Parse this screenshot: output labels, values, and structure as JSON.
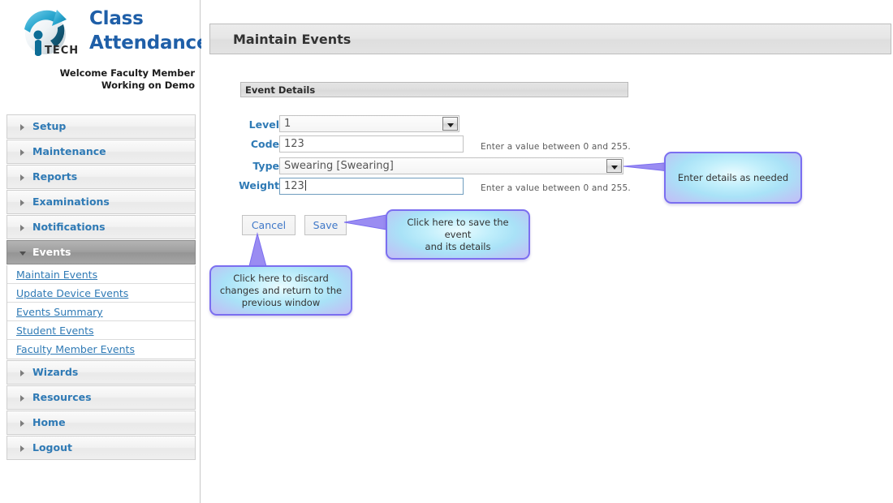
{
  "brand": {
    "logo_icon": "iptech-globe-arrow-logo",
    "title_line1": "Class",
    "title_line2": "Attendance",
    "welcome_line1": "Welcome Faculty Member",
    "welcome_line2": "Working on Demo",
    "brand_color": "#1f5fa8"
  },
  "sidebar": {
    "items": [
      {
        "label": "Setup",
        "state": "collapsed"
      },
      {
        "label": "Maintenance",
        "state": "collapsed"
      },
      {
        "label": "Reports",
        "state": "collapsed"
      },
      {
        "label": "Examinations",
        "state": "collapsed"
      },
      {
        "label": "Notifications",
        "state": "collapsed"
      },
      {
        "label": "Events",
        "state": "expanded"
      },
      {
        "label": "Wizards",
        "state": "collapsed"
      },
      {
        "label": "Resources",
        "state": "collapsed"
      },
      {
        "label": "Home",
        "state": "collapsed"
      },
      {
        "label": "Logout",
        "state": "collapsed"
      }
    ],
    "subitems": [
      {
        "label": "Maintain Events"
      },
      {
        "label": "Update Device Events"
      },
      {
        "label": "Events Summary"
      },
      {
        "label": "Student Events"
      },
      {
        "label": "Faculty Member Events"
      }
    ],
    "link_color": "#2f7ab5",
    "active_bg": "#9f9f9f"
  },
  "main": {
    "page_title": "Maintain Events",
    "section_title": "Event Details",
    "fields": {
      "level": {
        "label": "Level",
        "type": "select",
        "value": "1",
        "hint": ""
      },
      "code": {
        "label": "Code",
        "type": "text",
        "value": "123",
        "placeholder": "",
        "hint": "Enter a value between 0 and 255."
      },
      "event_type": {
        "label": "Type",
        "type": "select",
        "value": "Swearing [Swearing]",
        "hint": ""
      },
      "weight": {
        "label": "Weight",
        "type": "text",
        "value": "123",
        "placeholder": "",
        "hint": "Enter a value between 0 and 255.",
        "focused": true
      }
    },
    "buttons": {
      "cancel": "Cancel",
      "save": "Save"
    }
  },
  "callouts": {
    "enter_details": "Enter details as needed",
    "save_hint_line1": "Click here to save the event",
    "save_hint_line2": "and its details",
    "cancel_hint_line1": "Click here to discard",
    "cancel_hint_line2": "changes and return to the",
    "cancel_hint_line3": "previous window",
    "border_color": "#7b6ef0",
    "fill_color": "#a9e2f7"
  }
}
